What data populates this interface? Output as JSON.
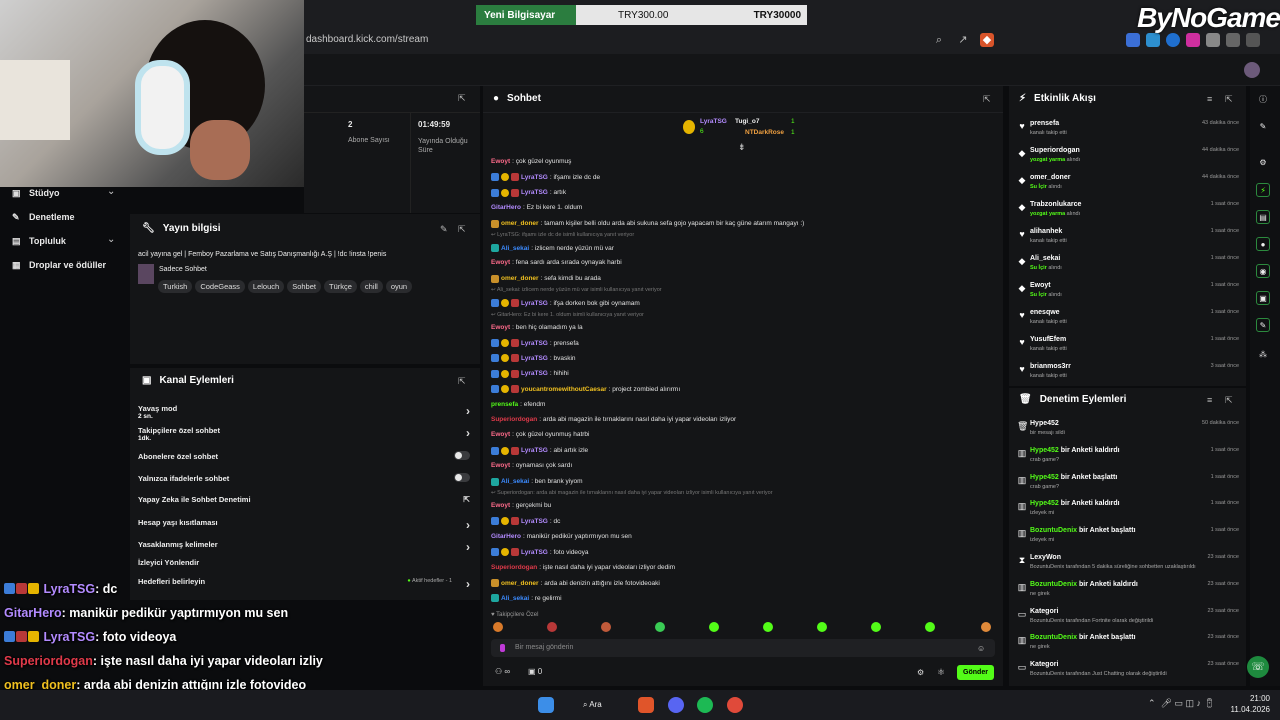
{
  "browser": {
    "url": "dashboard.kick.com/stream"
  },
  "price_banner": {
    "name": "Yeni Bilgisayar",
    "price1": "TRY300.00",
    "price2": "TRY30000"
  },
  "watermark": "ByNoGame",
  "left_nav": [
    {
      "label": "Stüdyo",
      "icon": "studio-icon"
    },
    {
      "label": "Denetleme",
      "icon": "wrench-icon"
    },
    {
      "label": "Topluluk",
      "icon": "community-icon"
    },
    {
      "label": "Droplar ve ödüller",
      "icon": "gift-icon"
    }
  ],
  "stats": {
    "subs_value": "2",
    "subs_label": "Abone Sayısı",
    "time_value": "01:49:59",
    "time_label": "Yayında Olduğu Süre"
  },
  "yayin": {
    "title": "Yayın bilgisi",
    "stream_title": "acil yayına gel | Femboy Pazarlama ve Satış Danışmanlığı A.Ş | !dc !insta !penis",
    "category": "Sadece Sohbet",
    "tags": [
      "Turkish",
      "CodeGeass",
      "Lelouch",
      "Sohbet",
      "Türkçe",
      "chill",
      "oyun"
    ]
  },
  "kanal": {
    "title": "Kanal Eylemleri",
    "rows": [
      {
        "label": "Yavaş mod",
        "sub": "2 sn."
      },
      {
        "label": "Takipçilere özel sohbet",
        "sub": "1dk."
      },
      {
        "label": "Abonelere özel sohbet"
      },
      {
        "label": "Yalnızca ifadelerle sohbet"
      },
      {
        "label": "Yapay Zeka ile Sohbet Denetimi"
      },
      {
        "label": "Hesap yaşı kısıtlaması"
      },
      {
        "label": "Yasaklanmış kelimeler"
      },
      {
        "label": "İzleyici Yönlendir"
      },
      {
        "label": "Hedefleri belirleyin",
        "sub": "Aktif hedefler - 1"
      }
    ]
  },
  "overlay": [
    {
      "user": "LyraTSG",
      "color": "#b38bff",
      "text": ": dc",
      "badges": true
    },
    {
      "user": "GitarHero",
      "color": "#b38bff",
      "text": ": manikür pedikür yaptırmıyon mu sen",
      "badges": false
    },
    {
      "user": "LyraTSG",
      "color": "#b38bff",
      "text": ": foto videoya",
      "badges": true
    },
    {
      "user": "Superiordogan",
      "color": "#e03a4a",
      "text": ": işte nasıl daha iyi yapar videoları izliy",
      "badges": false
    },
    {
      "user": "omer_doner",
      "color": "#f0c020",
      "text": ": arda abi denizin attığını izle fotovideo",
      "badges": false
    },
    {
      "user": "Ali_sekai",
      "color": "#3c8bff",
      "text": ": re gelirmi",
      "badges": false
    }
  ],
  "chat": {
    "title": "Sohbet",
    "top": [
      {
        "user": "LyraTSG",
        "count": "6"
      },
      {
        "user": "Tugi_o7",
        "count": "1"
      },
      {
        "user": "NTDarkRose",
        "count": "1"
      }
    ],
    "messages": [
      {
        "u": "Ewoyt",
        "c": "#ff6b8b",
        "t": ": çok güzel oyunmuş"
      },
      {
        "u": "LyraTSG",
        "c": "#b38bff",
        "t": ": ifşamı izle dc de",
        "b": 1
      },
      {
        "u": "LyraTSG",
        "c": "#b38bff",
        "t": ": artık",
        "b": 1
      },
      {
        "u": "GitarHero",
        "c": "#b38bff",
        "t": ": Ez bi kere 1. oldum"
      },
      {
        "u": "omer_doner",
        "c": "#f0c020",
        "t": ": tamam kişiler belli oldu arda abi sukuna sefa gojo yapacam bir kaç güne atarım mangayı :)",
        "b": 2
      },
      {
        "reply": "LyraTSG: ifşamı izle dc de isimli kullanıcıya yanıt veriyor"
      },
      {
        "u": "Ali_sekai",
        "c": "#3c8bff",
        "t": ": izlicem nerde yüzün mü var",
        "b": 3
      },
      {
        "u": "Ewoyt",
        "c": "#ff6b8b",
        "t": ": fena sardı arda sırada oynayak harbi"
      },
      {
        "u": "omer_doner",
        "c": "#f0c020",
        "t": ": sefa kimdi bu arada",
        "b": 2
      },
      {
        "reply": "Ali_sekai: izlicem nerde yüzün mü var isimli kullanıcıya yanıt veriyor"
      },
      {
        "u": "LyraTSG",
        "c": "#b38bff",
        "t": ": ifşa dorken bok gibi oynamam",
        "b": 1
      },
      {
        "reply": "GitarHero: Ez bi kere 1. oldum isimli kullanıcıya yanıt veriyor"
      },
      {
        "u": "Ewoyt",
        "c": "#ff6b8b",
        "t": ": ben hiç olamadım ya la"
      },
      {
        "u": "LyraTSG",
        "c": "#b38bff",
        "t": ": prensefa",
        "b": 1
      },
      {
        "u": "LyraTSG",
        "c": "#b38bff",
        "t": ": bvaskin",
        "b": 1
      },
      {
        "u": "LyraTSG",
        "c": "#b38bff",
        "t": ": hihihi",
        "b": 1
      },
      {
        "u": "youcantromewithoutCaesar",
        "c": "#f0c020",
        "t": ": project zombied alırırmı",
        "b": 1
      },
      {
        "u": "prensefa",
        "c": "#53fc18",
        "t": ": efendm"
      },
      {
        "u": "Superiordogan",
        "c": "#e03a4a",
        "t": ": arda abi magazin ile tırnaklarını nasıl daha iyi yapar videoları izliyor"
      },
      {
        "u": "Ewoyt",
        "c": "#ff6b8b",
        "t": ": çok güzel oyunmuş hatrbi"
      },
      {
        "u": "LyraTSG",
        "c": "#b38bff",
        "t": ": abi artık izle",
        "b": 1
      },
      {
        "u": "Ewoyt",
        "c": "#ff6b8b",
        "t": ": oynaması çok sardı"
      },
      {
        "u": "Ali_sekai",
        "c": "#3c8bff",
        "t": ": ben brank yiyom",
        "b": 3
      },
      {
        "reply": "Superiordogan: arda abi magazin ile tırnaklarını nasıl daha iyi yapar videoları izliyor isimli kullanıcıya yanıt veriyor"
      },
      {
        "u": "Ewoyt",
        "c": "#ff6b8b",
        "t": ": gerçekmi bu"
      },
      {
        "u": "LyraTSG",
        "c": "#b38bff",
        "t": ": dc",
        "b": 1
      },
      {
        "u": "GitarHero",
        "c": "#b38bff",
        "t": ": manikür pedikür yaptırmıyon mu sen"
      },
      {
        "u": "LyraTSG",
        "c": "#b38bff",
        "t": ": foto videoya",
        "b": 1
      },
      {
        "u": "Superiordogan",
        "c": "#e03a4a",
        "t": ": işte nasıl daha iyi yapar videoları izliyor dedim"
      },
      {
        "u": "omer_doner",
        "c": "#f0c020",
        "t": ": arda abi denizin attığını izle fotovideoaki",
        "b": 2
      },
      {
        "u": "Ali_sekai",
        "c": "#3c8bff",
        "t": ": re gelirmi",
        "b": 3
      }
    ],
    "followers_only": "Takipçilere Özel",
    "input_placeholder": "Bir mesaj gönderin",
    "points": "0",
    "send": "Gönder"
  },
  "etkinlik": {
    "title": "Etkinlik Akışı",
    "rows": [
      {
        "name": "prensefa",
        "sub": "kanalı takip etti",
        "time": "43 dakika önce",
        "type": "follow"
      },
      {
        "name": "Superiordogan",
        "sub": "yozgat yarma",
        "sub2": " alındı",
        "time": "44 dakika önce",
        "type": "redeem"
      },
      {
        "name": "omer_doner",
        "sub": "Su İçir",
        "sub2": " alındı",
        "time": "44 dakika önce",
        "type": "redeem"
      },
      {
        "name": "Trabzonlukarce",
        "sub": "yozgat yarma",
        "sub2": " alındı",
        "time": "1 saat önce",
        "type": "redeem"
      },
      {
        "name": "alihanhek",
        "sub": "kanalı takip etti",
        "time": "1 saat önce",
        "type": "follow"
      },
      {
        "name": "Ali_sekai",
        "sub": "Su İçir",
        "sub2": " alındı",
        "time": "1 saat önce",
        "type": "redeem"
      },
      {
        "name": "Ewoyt",
        "sub": "Su İçir",
        "sub2": " alındı",
        "time": "1 saat önce",
        "type": "redeem"
      },
      {
        "name": "enesqwe",
        "sub": "kanalı takip etti",
        "time": "1 saat önce",
        "type": "follow"
      },
      {
        "name": "YusufEfem",
        "sub": "kanalı takip etti",
        "time": "1 saat önce",
        "type": "follow"
      },
      {
        "name": "brianmos3rr",
        "sub": "kanalı takip etti",
        "time": "3 saat önce",
        "type": "follow"
      }
    ]
  },
  "denetim": {
    "title": "Denetim Eylemleri",
    "rows": [
      {
        "name": "Hype452",
        "rest": "",
        "sub": "bir mesajı sildi",
        "time": "50 dakika önce",
        "icon": "trash-icon",
        "green": false
      },
      {
        "name": "Hype452",
        "rest": " bir Anketi kaldırdı",
        "sub": "crab game?",
        "time": "1 saat önce",
        "icon": "poll-icon",
        "green": true
      },
      {
        "name": "Hype452",
        "rest": " bir Anket başlattı",
        "sub": "crab game?",
        "time": "1 saat önce",
        "icon": "poll-icon",
        "green": true
      },
      {
        "name": "Hype452",
        "rest": " bir Anketi kaldırdı",
        "sub": "izleyek mi",
        "time": "1 saat önce",
        "icon": "poll-icon",
        "green": true
      },
      {
        "name": "BozuntuDenix",
        "rest": " bir Anket başlattı",
        "sub": "izleyek mi",
        "time": "1 saat önce",
        "icon": "poll-icon",
        "green": true
      },
      {
        "name": "LexyWon",
        "rest": "",
        "sub": "BozuntuDenix tarafından 5 dakika süreliğine sohbetten uzaklaştırıldı",
        "time": "23 saat önce",
        "icon": "hourglass-icon",
        "green": false
      },
      {
        "name": "BozuntuDenix",
        "rest": " bir Anketi kaldırdı",
        "sub": "ne girek",
        "time": "23 saat önce",
        "icon": "poll-icon",
        "green": true
      },
      {
        "name": "Kategori",
        "rest": "",
        "sub": "BozuntuDenix tarafından Fortnite olarak değiştirildi",
        "time": "23 saat önce",
        "icon": "category-icon",
        "green": false
      },
      {
        "name": "BozuntuDenix",
        "rest": " bir Anket başlattı",
        "sub": "ne girek",
        "time": "23 saat önce",
        "icon": "poll-icon",
        "green": true
      },
      {
        "name": "Kategori",
        "rest": "",
        "sub": "BozuntuDenix tarafından Just Chatting olarak değiştirildi",
        "time": "23 saat önce",
        "icon": "category-icon",
        "green": false
      }
    ]
  },
  "taskbar": {
    "search": "Ara",
    "time": "21:00",
    "date": "11.04.2026"
  }
}
